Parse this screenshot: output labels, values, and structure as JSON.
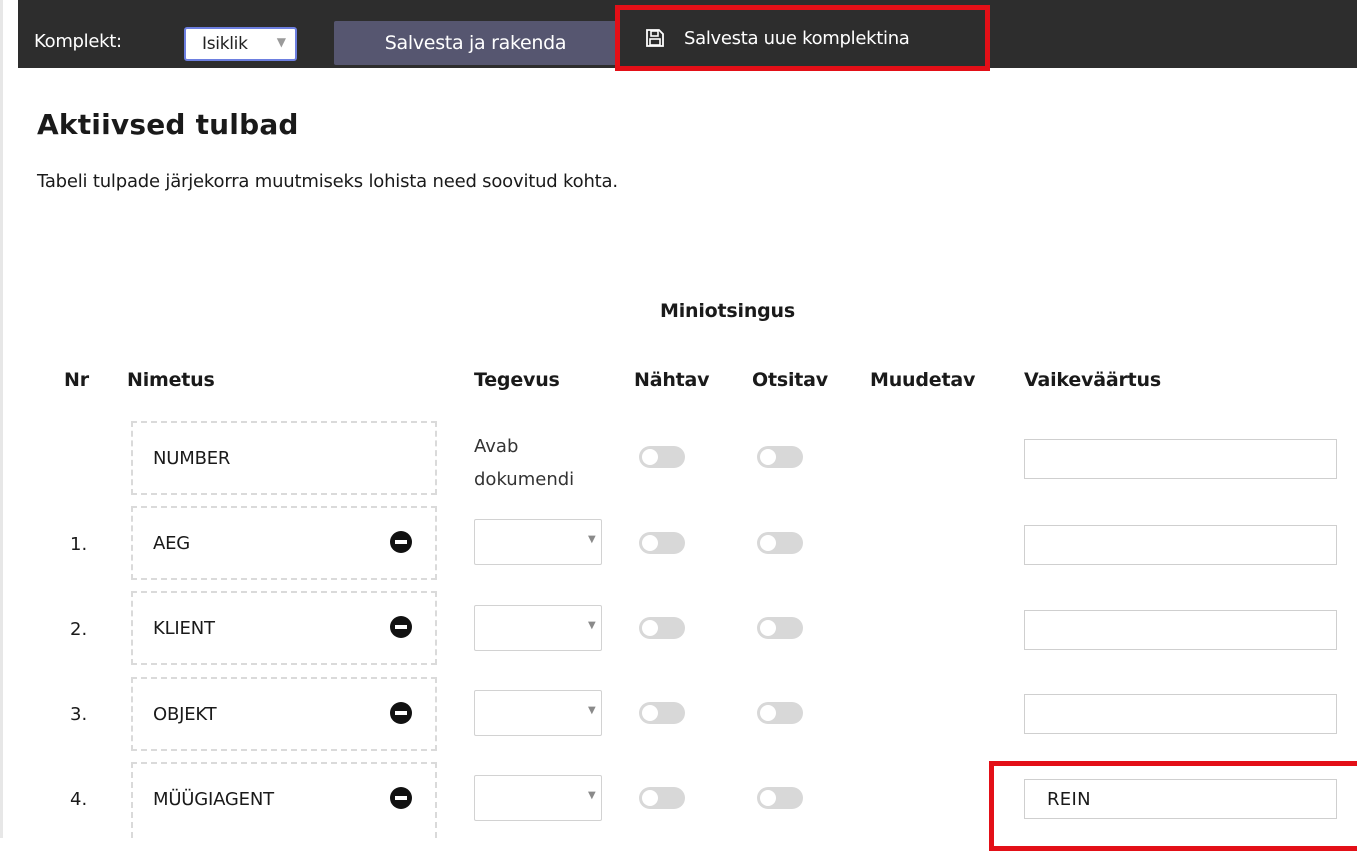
{
  "toolbar": {
    "set_label": "Komplekt:",
    "set_value": "Isiklik",
    "apply_label": "Salvesta ja rakenda",
    "save_as_label": "Salvesta uue komplektina"
  },
  "page": {
    "title": "Aktiivsed tulbad",
    "description": "Tabeli tulpade järjekorra muutmiseks lohista need soovitud kohta."
  },
  "table": {
    "group_header": "Miniotsingus",
    "headers": {
      "nr": "Nr",
      "name": "Nimetus",
      "action": "Tegevus",
      "visible": "Nähtav",
      "searchable": "Otsitav",
      "editable": "Muudetav",
      "default": "Vaikeväärtus"
    },
    "rows": [
      {
        "nr": "",
        "name": "NUMBER",
        "action": "Avab dokumendi",
        "visible": false,
        "searchable": false,
        "default": ""
      },
      {
        "nr": "1.",
        "name": "AEG",
        "action": "",
        "visible": false,
        "searchable": false,
        "default": ""
      },
      {
        "nr": "2.",
        "name": "KLIENT",
        "action": "",
        "visible": false,
        "searchable": false,
        "default": ""
      },
      {
        "nr": "3.",
        "name": "OBJEKT",
        "action": "",
        "visible": false,
        "searchable": false,
        "default": ""
      },
      {
        "nr": "4.",
        "name": "MÜÜGIAGENT",
        "action": "",
        "visible": false,
        "searchable": false,
        "default": "REIN"
      }
    ]
  },
  "colors": {
    "topbar": "#2d2d2d",
    "apply_button": "#565670",
    "highlight": "#e30f17",
    "select_border": "#6d7fe0"
  }
}
